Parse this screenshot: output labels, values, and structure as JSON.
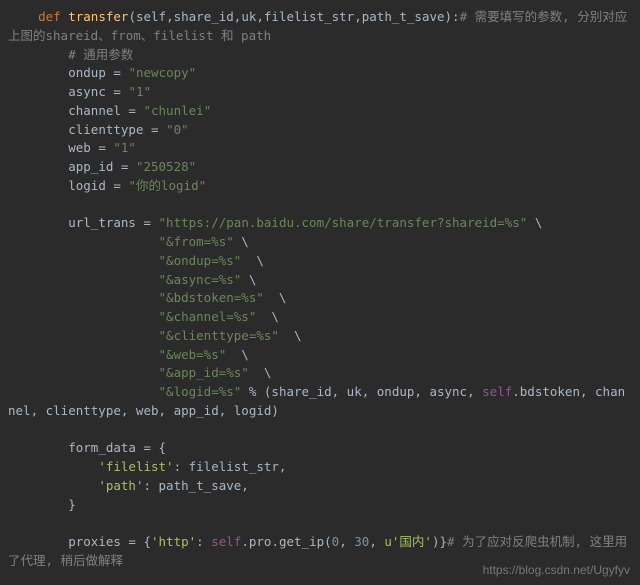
{
  "code": {
    "def": "def",
    "fname": "transfer",
    "sig_open": "(",
    "params": "self,share_id,uk,filelist_str,path_t_save",
    "sig_close": "):",
    "c_def": "# 需要填写的参数, 分别对应上图的shareid、from、filelist 和 path",
    "c_common": "# 通用参数",
    "ondup_lhs": "ondup = ",
    "ondup_val": "\"newcopy\"",
    "async_lhs": "async = ",
    "async_val": "\"1\"",
    "channel_lhs": "channel = ",
    "channel_val": "\"chunlei\"",
    "clienttype_lhs": "clienttype = ",
    "clienttype_val": "\"0\"",
    "web_lhs": "web = ",
    "web_val": "\"1\"",
    "app_id_lhs": "app_id = ",
    "app_id_val": "\"250528\"",
    "logid_lhs": "logid = ",
    "logid_val": "\"你的logid\"",
    "url_lhs": "url_trans = ",
    "url_v0": "\"https://pan.baidu.com/share/transfer?shareid=%s\"",
    "url_v1": "\"&from=%s\"",
    "url_v2": "\"&ondup=%s\"",
    "url_v3": "\"&async=%s\"",
    "url_v4": "\"&bdstoken=%s\"",
    "url_v5": "\"&channel=%s\"",
    "url_v6": "\"&clienttype=%s\"",
    "url_v7": "\"&web=%s\"",
    "url_v8": "\"&app_id=%s\"",
    "url_v9": "\"&logid=%s\"",
    "url_tail1": " % (share_id, uk, ondup, async, ",
    "self_kw": "self",
    "url_tail2": ".bdstoken, channel, clienttype, web, app_id, logid)",
    "fd_lhs": "form_data = {",
    "fd_k1": "'filelist'",
    "fd_v1": ": filelist_str,",
    "fd_k2": "'path'",
    "fd_v2": ": path_t_save,",
    "fd_close": "}",
    "prox_lhs": "proxies = {",
    "prox_k": "'http'",
    "prox_mid": ": ",
    "prox_selfcall": ".pro.get_ip(",
    "prox_n1": "0",
    "prox_n2": "30",
    "prox_u": "u'国内'",
    "prox_end": ")}",
    "c_prox": "# 为了应对反爬虫机制, 这里用了代理, 稍后做解释"
  },
  "watermark": "https://blog.csdn.net/Ugyfyv"
}
